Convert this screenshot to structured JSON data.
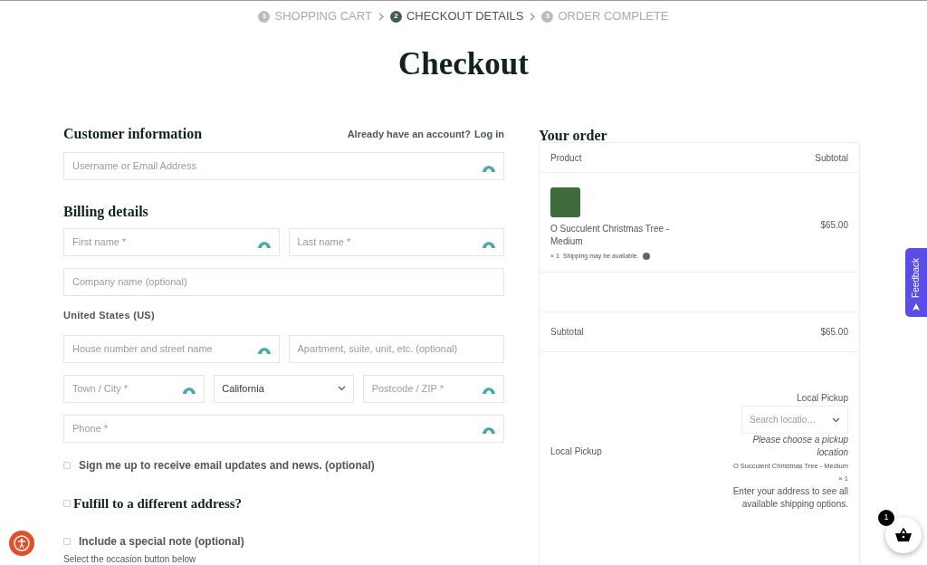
{
  "steps": [
    {
      "number": "1",
      "label": "SHOPPING CART",
      "selected": false
    },
    {
      "number": "2",
      "label": "CHECKOUT DETAILS",
      "selected": true
    },
    {
      "number": "3",
      "label": "ORDER COMPLETE",
      "selected": false
    }
  ],
  "title": "Checkout",
  "customer": {
    "heading": "Customer information",
    "account_prompt": "Already have an account?",
    "login_link": "Log in",
    "field": {
      "placeholder": "Username or Email Address",
      "autofill_icon": true
    }
  },
  "billing": {
    "heading": "Billing details",
    "rows": [
      [
        {
          "kind": "input",
          "placeholder": "First name *",
          "autofill_icon": true
        },
        {
          "kind": "input",
          "placeholder": "Last name *",
          "autofill_icon": true
        }
      ],
      [
        {
          "kind": "input",
          "placeholder": "Company name (optional)",
          "autofill_icon": false
        }
      ],
      [
        {
          "kind": "label",
          "text": "United States (US)"
        }
      ],
      [
        {
          "kind": "input",
          "placeholder": "House number and street name",
          "autofill_icon": true
        },
        {
          "kind": "input",
          "placeholder": "Apartment, suite, unit, etc. (optional)",
          "autofill_icon": false
        }
      ],
      [
        {
          "kind": "input",
          "placeholder": "Town / City *",
          "autofill_icon": true
        },
        {
          "kind": "select",
          "value": "California"
        },
        {
          "kind": "input",
          "placeholder": "Postcode / ZIP *",
          "autofill_icon": true
        }
      ],
      [
        {
          "kind": "input",
          "placeholder": "Phone *",
          "autofill_icon": true
        }
      ]
    ]
  },
  "options": [
    {
      "kind": "checkbox",
      "label": "Sign me up to receive email updates and news. (optional)",
      "checked": false
    },
    {
      "kind": "heading",
      "label": "Fulfill to a different address?",
      "checked": false
    },
    {
      "kind": "checkbox",
      "label": "Include a special note (optional)",
      "checked": false
    }
  ],
  "footer_text": "Select the occasion button below",
  "order": {
    "heading": "Your order",
    "columns": [
      "Product",
      "Subtotal"
    ],
    "item": {
      "name": "O Succulent Christmas Tree - Medium",
      "quantity": "× 1",
      "shipping_note": "Shipping may be available.",
      "price": "$65.00"
    },
    "subtotal": {
      "label": "Subtotal",
      "value": "$65.00"
    },
    "pickup": {
      "label": "Local Pickup",
      "option_title": "Local Pickup",
      "search_placeholder": "Search locatio…",
      "prompt": "Please choose a pickup location",
      "package": "O Succulent Christmas Tree - Medium × 1",
      "address_note": "Enter your address to see all available shipping options."
    }
  },
  "feedback_tab": "Feedback",
  "cart_count": "1"
}
